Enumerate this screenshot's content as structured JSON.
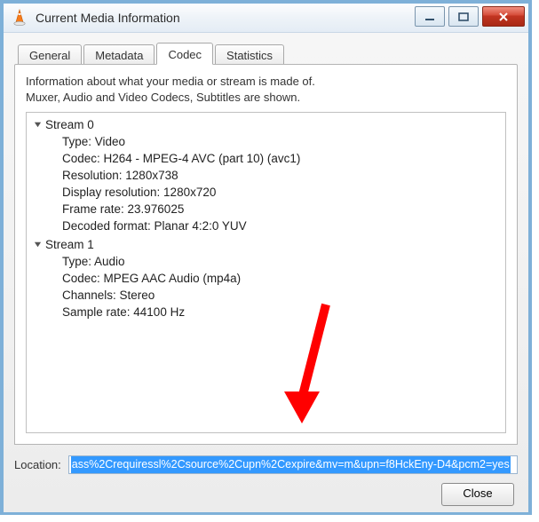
{
  "window": {
    "title": "Current Media Information"
  },
  "tabs": [
    {
      "label": "General"
    },
    {
      "label": "Metadata"
    },
    {
      "label": "Codec"
    },
    {
      "label": "Statistics"
    }
  ],
  "active_tab_index": 2,
  "info_lines": [
    "Information about what your media or stream is made of.",
    "Muxer, Audio and Video Codecs, Subtitles are shown."
  ],
  "streams": [
    {
      "header": "Stream 0",
      "props": [
        "Type: Video",
        "Codec: H264 - MPEG-4 AVC (part 10) (avc1)",
        "Resolution: 1280x738",
        "Display resolution: 1280x720",
        "Frame rate: 23.976025",
        "Decoded format: Planar 4:2:0 YUV"
      ]
    },
    {
      "header": "Stream 1",
      "props": [
        "Type: Audio",
        "Codec: MPEG AAC Audio (mp4a)",
        "Channels: Stereo",
        "Sample rate: 44100 Hz"
      ]
    }
  ],
  "location": {
    "label": "Location:",
    "value": "ass%2Crequiressl%2Csource%2Cupn%2Cexpire&mv=m&upn=f8HckEny-D4&pcm2=yes"
  },
  "close_button": "Close"
}
